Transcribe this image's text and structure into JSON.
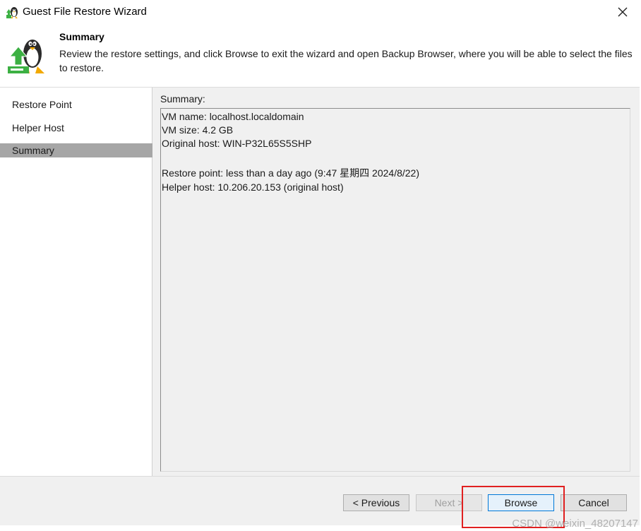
{
  "window": {
    "title": "Guest File Restore Wizard",
    "close_symbol": "✕"
  },
  "header": {
    "title": "Summary",
    "description": "Review the restore settings, and click Browse to exit the wizard and open Backup Browser, where you will be able to select the files to restore.",
    "icon": "linux-restore-icon"
  },
  "sidebar": {
    "items": [
      {
        "label": "Restore Point",
        "selected": false
      },
      {
        "label": "Helper Host",
        "selected": false
      },
      {
        "label": "Summary",
        "selected": true
      }
    ]
  },
  "summary": {
    "label": "Summary:",
    "lines": [
      "VM name: localhost.localdomain",
      "VM size: 4.2 GB",
      "Original host: WIN-P32L65S5SHP",
      "",
      "Restore point: less than a day ago (9:47 星期四 2024/8/22)",
      "Helper host: 10.206.20.153 (original host)"
    ]
  },
  "buttons": {
    "previous": "< Previous",
    "next": "Next >",
    "browse": "Browse",
    "cancel": "Cancel"
  },
  "watermark": "CSDN @weixin_48207147",
  "colors": {
    "accent_green": "#3cb043",
    "selected_nav": "#a6a6a6",
    "highlight_red": "#e02020",
    "focus_blue": "#0078d7"
  }
}
